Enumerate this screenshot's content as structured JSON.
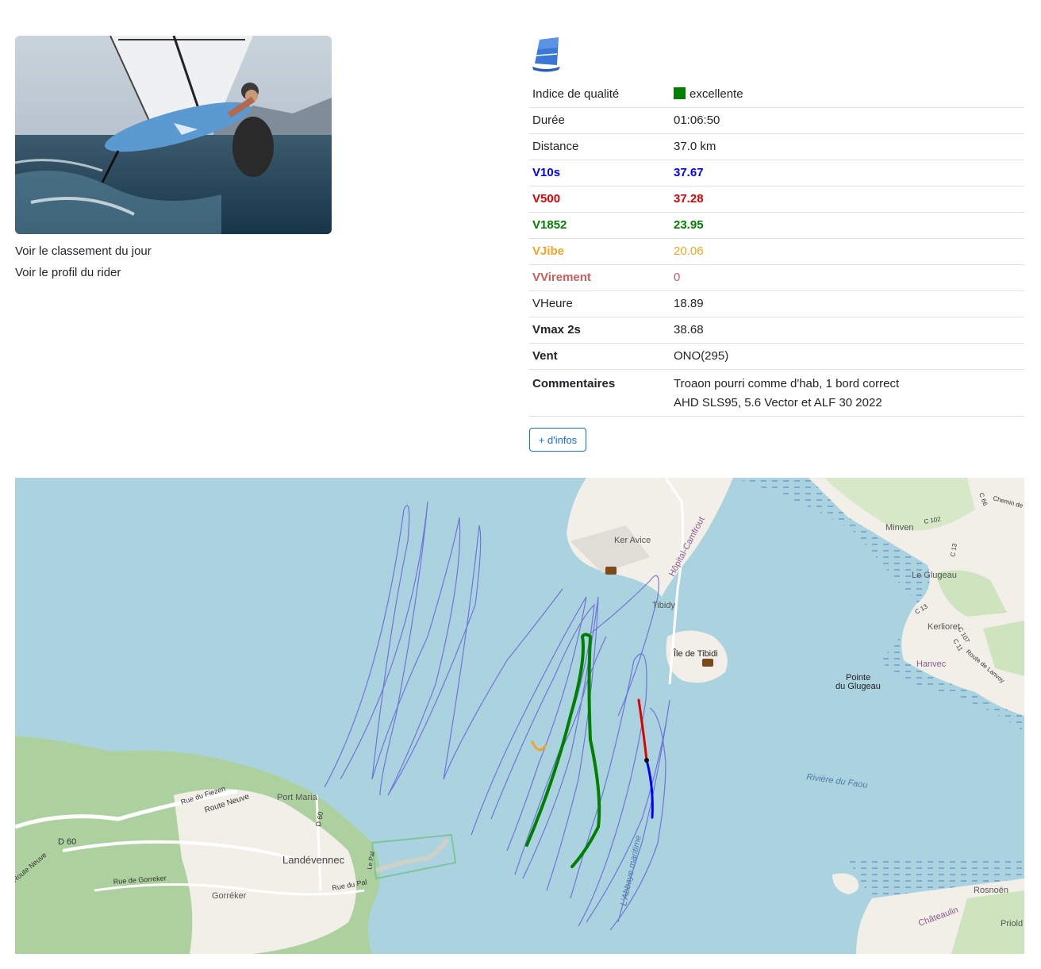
{
  "photo": {
    "alt": "windsurfer"
  },
  "links": {
    "ranking": "Voir le classement du jour",
    "profile": "Voir le profil du rider"
  },
  "stats": {
    "quality": {
      "label": "Indice de qualité",
      "value": "excellente",
      "color": "#008000"
    },
    "duration": {
      "label": "Durée",
      "value": "01:06:50"
    },
    "distance": {
      "label": "Distance",
      "value": "37.0 km"
    },
    "v10s": {
      "label": "V10s",
      "value": "37.67",
      "color": "#0000ff"
    },
    "v500": {
      "label": "V500",
      "value": "37.28",
      "color": "#e00000"
    },
    "v1852": {
      "label": "V1852",
      "value": "23.95",
      "color": "#008000"
    },
    "vjibe": {
      "label": "VJibe",
      "value": "20.06",
      "color": "#f4a321"
    },
    "virement": {
      "label": "VVirement",
      "value": "0",
      "color": "#cd5c5c"
    },
    "vheure": {
      "label": "VHeure",
      "value": "18.89"
    },
    "vmax": {
      "label": "Vmax 2s",
      "value": "38.68"
    },
    "vent": {
      "label": "Vent",
      "value": "ONO(295)"
    },
    "comments": {
      "label": "Commentaires",
      "line1": "Troaon pourri comme d'hab, 1 bord correct",
      "line2": "AHD SLS95, 5.6 Vector et ALF 30 2022"
    }
  },
  "more_button": "+ d'infos",
  "map": {
    "labels": {
      "ker_avice": "Ker Avice",
      "hopital": "Hôpital-Camfrout",
      "tibidy": "Tibidy",
      "ile_tibidi": "Île de Tibidi",
      "minven": "Minven",
      "le_glugeau": "Le Glugeau",
      "kerlioret": "Kerlioret",
      "hanvec": "Hanvec",
      "pointe1": "Pointe",
      "pointe2": "du Glugeau",
      "riviere_faou": "Rivière du Faou",
      "abbaye": "L'Abbaye maritime",
      "port_maria": "Port Maria",
      "landevennec": "Landévennec",
      "gorreker": "Gorréker",
      "rue_fiezen": "Rue du Fiezen",
      "route_neuve": "Route Neuve",
      "route_neuve2": "Route Neuve",
      "d60": "D 60",
      "d60b": "D 60",
      "rue_gorreker": "Rue de Gorreker",
      "rue_pal": "Rue du Pal",
      "le_pal": "Le Pal",
      "rosnoen": "Rosnoën",
      "chateaulin": "Châteaulin",
      "priold": "Priold",
      "c102": "C 102",
      "c13": "C 13",
      "c13b": "C 13",
      "c66": "C 66",
      "chemin": "Chemin de",
      "c107": "C 107",
      "c11": "C 11",
      "route_lanvoy": "Route de Lanvoy"
    },
    "colors": {
      "water": "#aad3df",
      "land": "#f2efe9",
      "forest": "#add19e",
      "track": "#6a6ad8",
      "v1852": "#008000",
      "v500": "#e00000",
      "v10s": "#0000ff",
      "vjibe": "#f4a321"
    }
  }
}
